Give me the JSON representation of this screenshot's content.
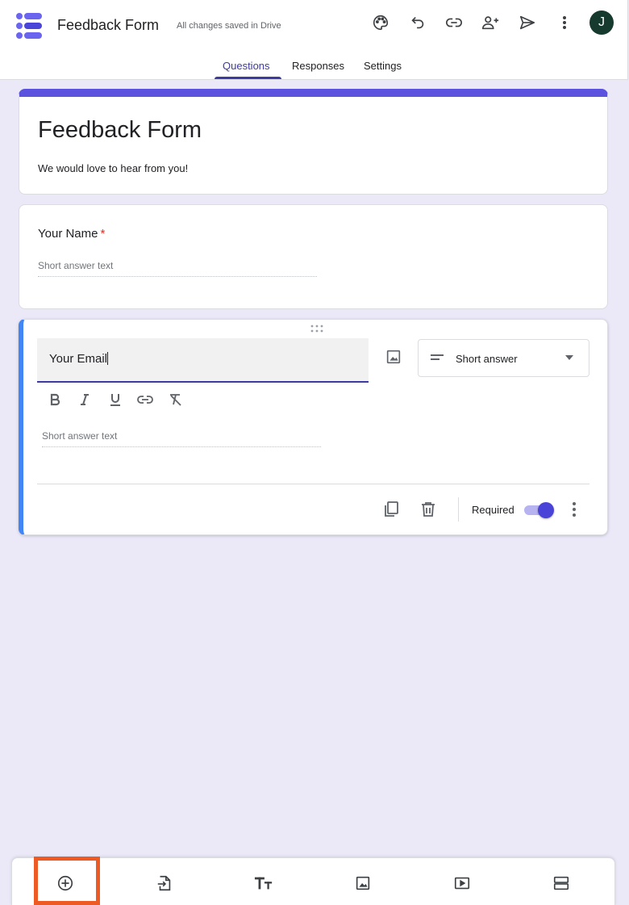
{
  "header": {
    "app_title": "Feedback Form",
    "save_status": "All changes saved in Drive",
    "avatar_initial": "J",
    "icons": [
      "palette-icon",
      "undo-icon",
      "link-icon",
      "add-collaborator-icon",
      "send-icon",
      "more-vert-icon"
    ]
  },
  "tabs": [
    {
      "label": "Questions",
      "active": true
    },
    {
      "label": "Responses",
      "active": false
    },
    {
      "label": "Settings",
      "active": false
    }
  ],
  "form": {
    "title": "Feedback Form",
    "description": "We would love to hear from you!"
  },
  "questions": [
    {
      "label": "Your Name",
      "required_mark": "*",
      "answer_placeholder": "Short answer text"
    },
    {
      "label": "Your Email",
      "type": "Short answer",
      "answer_placeholder": "Short answer text",
      "required_label": "Required",
      "required": true
    }
  ],
  "toolbar": {
    "tools": [
      "add-question-icon",
      "import-questions-icon",
      "add-title-icon",
      "add-image-icon",
      "add-video-icon",
      "add-section-icon"
    ]
  },
  "colors": {
    "accent": "#3d3aa1",
    "title_bar": "#5b53e0",
    "active_question": "#4285f4",
    "background": "#ebe9f8",
    "highlight": "#ee5a24"
  }
}
